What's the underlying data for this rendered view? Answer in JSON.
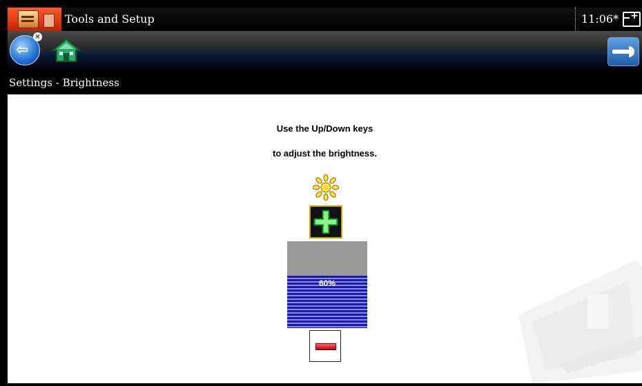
{
  "titlebar": {
    "title": "Tools and Setup",
    "clock": "11:06*",
    "logo_icon": "toolbox-icon",
    "battery_icon": "battery-charging-icon"
  },
  "toolbar": {
    "back_icon": "back-arrow-icon",
    "home_icon": "home-icon",
    "tools_icon": "wrench-icon"
  },
  "subtitle": "Settings - Brightness",
  "instructions": {
    "line1": "Use the Up/Down keys",
    "line2": "to adjust the brightness."
  },
  "brightness": {
    "value_label": "60%",
    "level": 0.6,
    "increase_icon": "plus-icon",
    "decrease_icon": "minus-icon",
    "indicator_icon": "sun-icon"
  },
  "colors": {
    "accent_orange": "#e03a10",
    "bar_blue": "#1a1aa8",
    "bar_empty": "#999999",
    "plus_green": "#2fbf2f",
    "minus_red": "#d01010"
  }
}
